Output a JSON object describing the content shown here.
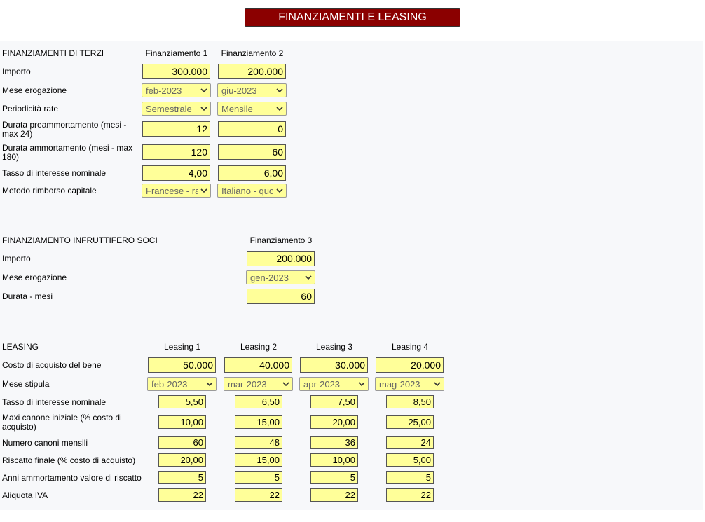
{
  "title": "FINANZIAMENTI E LEASING",
  "terzi": {
    "section_label": "FINANZIAMENTI DI TERZI",
    "col1": "Finanziamento 1",
    "col2": "Finanziamento 2",
    "labels": {
      "importo": "Importo",
      "mese": "Mese erogazione",
      "periodicita": "Periodicità rate",
      "preamm_l1": "Durata preammortamento (mesi -",
      "preamm_l2": "max 24)",
      "amm_l1": "Durata ammortamento (mesi - max",
      "amm_l2": "180)",
      "tasso": "Tasso di interesse nominale",
      "metodo": "Metodo rimborso capitale"
    },
    "f1": {
      "importo": "300.000",
      "mese": "feb-2023",
      "periodicita": "Semestrale",
      "preamm": "12",
      "amm": "120",
      "tasso": "4,00",
      "metodo": "Francese - ra"
    },
    "f2": {
      "importo": "200.000",
      "mese": "giu-2023",
      "periodicita": "Mensile",
      "preamm": "0",
      "amm": "60",
      "tasso": "6,00",
      "metodo": "Italiano - quo"
    }
  },
  "soci": {
    "section_label": "FINANZIAMENTO INFRUTTIFERO SOCI",
    "col": "Finanziamento 3",
    "labels": {
      "importo": "Importo",
      "mese": "Mese erogazione",
      "durata": "Durata - mesi"
    },
    "importo": "200.000",
    "mese": "gen-2023",
    "durata": "60"
  },
  "leasing": {
    "section_label": "LEASING",
    "cols": [
      "Leasing 1",
      "Leasing 2",
      "Leasing 3",
      "Leasing 4"
    ],
    "labels": {
      "costo": "Costo di acquisto del bene",
      "stipula": "Mese stipula",
      "tasso": "Tasso di interesse nominale",
      "maxi_l1": "Maxi canone iniziale (% costo di",
      "maxi_l2": "acquisto)",
      "canoni": "Numero canoni mensili",
      "riscatto": "Riscatto finale (% costo di acquisto)",
      "anni": "Anni ammortamento valore di riscatto",
      "iva": "Aliquota IVA"
    },
    "items": [
      {
        "costo": "50.000",
        "stipula": "feb-2023",
        "tasso": "5,50",
        "maxi": "10,00",
        "canoni": "60",
        "riscatto": "20,00",
        "anni": "5",
        "iva": "22"
      },
      {
        "costo": "40.000",
        "stipula": "mar-2023",
        "tasso": "6,50",
        "maxi": "15,00",
        "canoni": "48",
        "riscatto": "15,00",
        "anni": "5",
        "iva": "22"
      },
      {
        "costo": "30.000",
        "stipula": "apr-2023",
        "tasso": "7,50",
        "maxi": "20,00",
        "canoni": "36",
        "riscatto": "10,00",
        "anni": "5",
        "iva": "22"
      },
      {
        "costo": "20.000",
        "stipula": "mag-2023",
        "tasso": "8,50",
        "maxi": "25,00",
        "canoni": "24",
        "riscatto": "5,00",
        "anni": "5",
        "iva": "22"
      }
    ]
  },
  "colors": {
    "title_bg": "#8b0000",
    "field_bg": "#ffff99",
    "panel_bg": "#f7f8fa"
  }
}
